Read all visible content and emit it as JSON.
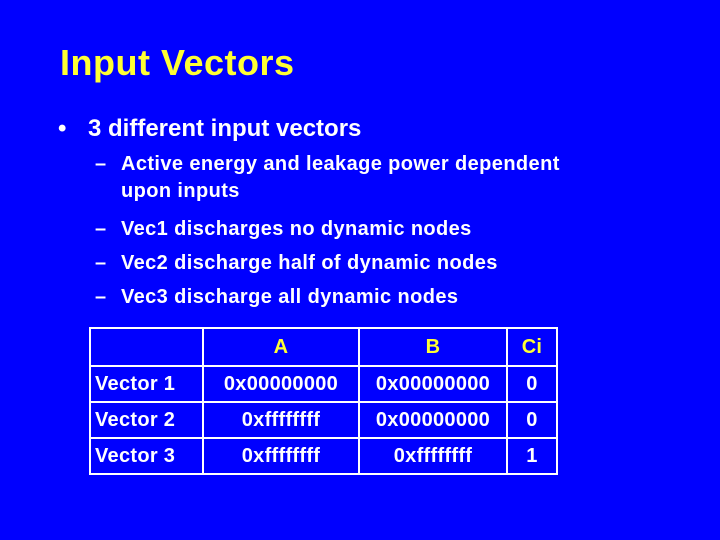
{
  "slide": {
    "title": "Input Vectors",
    "bullets": [
      {
        "marker": "•",
        "text": "3 different input vectors",
        "sub_bullets": [
          {
            "marker": "–",
            "line1": "Active energy and leakage power dependent",
            "line2": "upon inputs"
          },
          {
            "marker": "–",
            "line1": "Vec1 discharges no dynamic nodes"
          },
          {
            "marker": "–",
            "line1": "Vec2 discharge half of dynamic nodes"
          },
          {
            "marker": "–",
            "line1": "Vec3 discharge all dynamic nodes"
          }
        ]
      }
    ],
    "table": {
      "headers": [
        "",
        "A",
        "B",
        "Ci"
      ],
      "rows": [
        [
          "Vector 1",
          "0x00000000",
          "0x00000000",
          "0"
        ],
        [
          "Vector 2",
          "0xffffffff",
          "0x00000000",
          "0"
        ],
        [
          "Vector 3",
          "0xffffffff",
          "0xffffffff",
          "1"
        ]
      ]
    },
    "colors": {
      "background": "#0000ff",
      "title": "#ffff33",
      "header_text": "#ffff33",
      "body_text": "#ffffff",
      "table_border": "#ffffff"
    }
  }
}
